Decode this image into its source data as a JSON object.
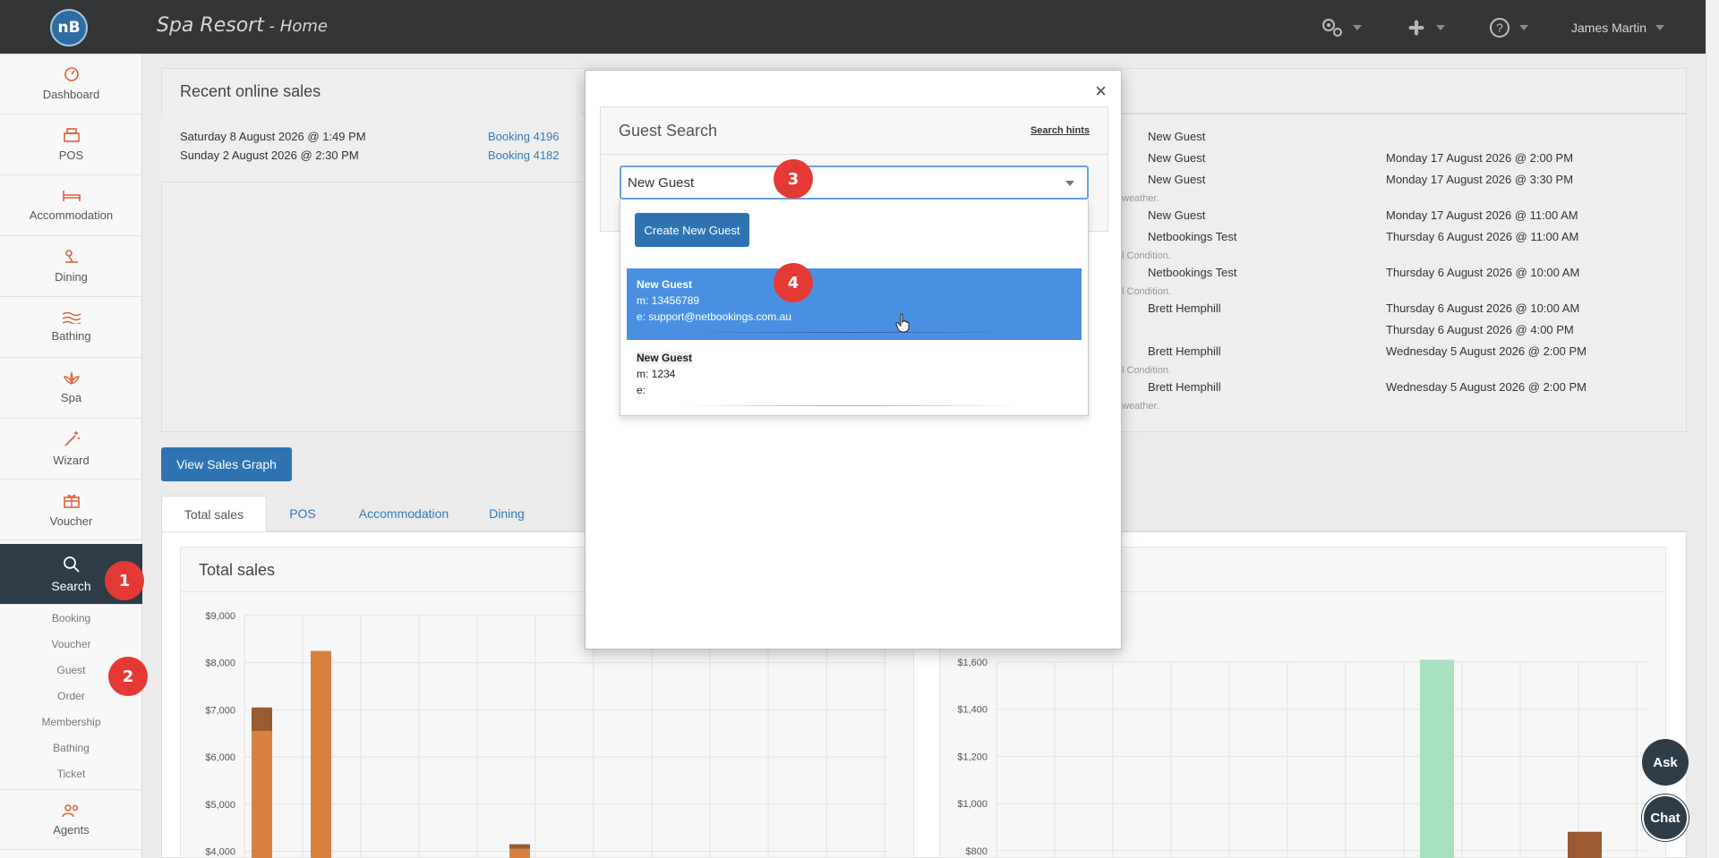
{
  "header": {
    "logo_text": "nB",
    "title": "Spa Resort",
    "title_sep": " - ",
    "title_page": "Home",
    "user_name": "James Martin"
  },
  "sidebar": {
    "items": [
      {
        "label": "Dashboard",
        "icon": "gauge-icon"
      },
      {
        "label": "POS",
        "icon": "register-icon"
      },
      {
        "label": "Accommodation",
        "icon": "bed-icon"
      },
      {
        "label": "Dining",
        "icon": "dining-icon"
      },
      {
        "label": "Bathing",
        "icon": "water-icon"
      },
      {
        "label": "Spa",
        "icon": "lotus-icon"
      },
      {
        "label": "Wizard",
        "icon": "magic-wand-icon"
      },
      {
        "label": "Voucher",
        "icon": "gift-icon"
      },
      {
        "label": "Search",
        "icon": "search-icon"
      }
    ],
    "search_sub": [
      "Booking",
      "Voucher",
      "Guest",
      "Order",
      "Membership",
      "Bathing",
      "Ticket"
    ],
    "agents_label": "Agents"
  },
  "recent_sales": {
    "title": "Recent online sales",
    "rows": [
      {
        "date": "Saturday 8 August 2026 @ 1:49 PM",
        "booking": "Booking 4196"
      },
      {
        "date": "Sunday 2 August 2026 @ 2:30 PM",
        "booking": "Booking 4182"
      }
    ]
  },
  "right_list": {
    "rows": [
      {
        "guest": "New Guest",
        "date": ""
      },
      {
        "guest": "New Guest",
        "date": "Monday 17 August 2026 @ 2:00 PM"
      },
      {
        "guest": "New Guest",
        "date": "Monday 17 August 2026 @ 3:30 PM"
      },
      {
        "guest": "New Guest",
        "date": "Monday 17 August 2026 @ 11:00 AM"
      },
      {
        "guest": "Netbookings Test",
        "date": "Thursday 6 August 2026 @ 11:00 AM"
      },
      {
        "guest": "Netbookings Test",
        "date": "Thursday 6 August 2026 @ 10:00 AM"
      },
      {
        "guest": "Brett Hemphill",
        "date": "Thursday 6 August 2026 @ 10:00 AM"
      },
      {
        "guest": "",
        "date": "Thursday 6 August 2026 @ 4:00 PM"
      },
      {
        "guest": "Brett Hemphill",
        "date": "Wednesday 5 August 2026 @ 2:00 PM"
      },
      {
        "guest": "Brett Hemphill",
        "date": "Wednesday 5 August 2026 @ 2:00 PM"
      }
    ],
    "notes": [
      "weather.",
      "l Condition.",
      "l Condition.",
      "l Condition.",
      "weather."
    ]
  },
  "view_sales_graph": "View Sales Graph",
  "tabs": [
    "Total sales",
    "POS",
    "Accommodation",
    "Dining"
  ],
  "total_sales_title": "Total sales",
  "modal": {
    "title": "Guest Search",
    "hints": "Search hints",
    "close": "×",
    "selected_value": "New Guest",
    "create_button": "Create New Guest",
    "results": [
      {
        "name": "New Guest",
        "mobile": "m: 13456789",
        "email": "e: support@netbookings.com.au"
      },
      {
        "name_a": "New",
        "name_b": "Guest",
        "mobile": "m: 1234",
        "email": "e:"
      }
    ]
  },
  "badges": [
    "1",
    "2",
    "3",
    "4"
  ],
  "floating": {
    "ask": "Ask",
    "chat": "Chat"
  },
  "colors": {
    "topbar": "#333537",
    "sidebar_active": "#2e3d48",
    "primary": "#2f73b2",
    "selected_row": "#4a90e2",
    "badge": "#e53935",
    "bar_orange": "#d9823f",
    "bar_brown": "#9a5a32",
    "bar_green": "#a8e0c0"
  },
  "chart_data": [
    {
      "type": "bar",
      "title": "Total sales",
      "yticks": [
        "$9,000",
        "$8,000",
        "$7,000",
        "$6,000",
        "$5,000",
        "$4,000"
      ],
      "ylim": [
        4000,
        9000
      ],
      "series": [
        {
          "values": [
            6550,
            8250,
            0,
            0,
            4050
          ]
        },
        {
          "values": [
            500,
            0,
            0,
            0,
            100
          ]
        }
      ]
    },
    {
      "type": "bar",
      "yticks": [
        "$1,600",
        "$1,400",
        "$1,200",
        "$1,000",
        "$800"
      ],
      "ylim": [
        800,
        1650
      ],
      "series": [
        {
          "values": [
            1610,
            880
          ]
        }
      ]
    }
  ]
}
